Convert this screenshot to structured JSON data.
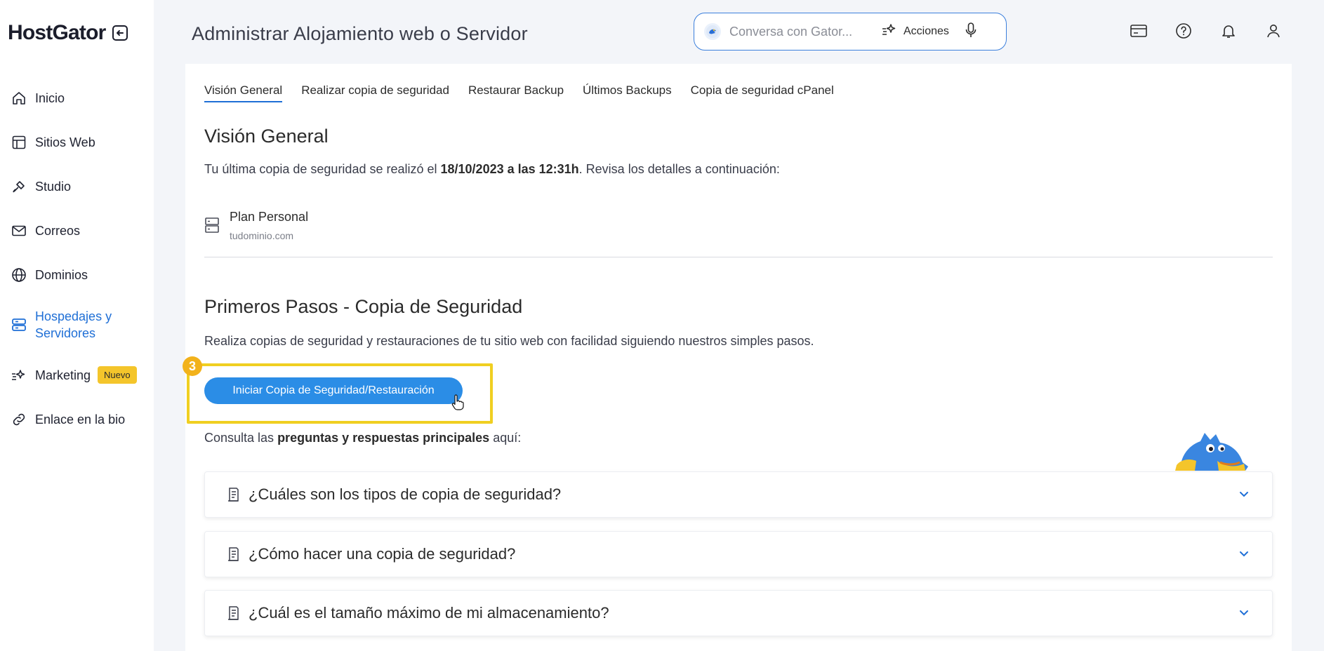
{
  "app": {
    "logo": "HostGator"
  },
  "sidebar": {
    "items": [
      {
        "label": "Inicio",
        "icon": "home-icon"
      },
      {
        "label": "Sitios Web",
        "icon": "layout-icon"
      },
      {
        "label": "Studio",
        "icon": "brush-icon"
      },
      {
        "label": "Correos",
        "icon": "mail-icon"
      },
      {
        "label": "Dominios",
        "icon": "globe-icon"
      },
      {
        "label": "Hospedajes y Servidores",
        "icon": "server-icon",
        "active": true
      },
      {
        "label": "Marketing",
        "icon": "sparkle-icon",
        "badge": "Nuevo"
      },
      {
        "label": "Enlace en la bio",
        "icon": "link-icon"
      }
    ]
  },
  "header": {
    "title": "Administrar Alojamiento web o Servidor",
    "chat": {
      "placeholder": "Conversa con Gator...",
      "actions_label": "Acciones"
    }
  },
  "tabs": [
    "Visión General",
    "Realizar copia de seguridad",
    "Restaurar Backup",
    "Últimos Backups",
    "Copia de seguridad cPanel"
  ],
  "overview": {
    "title": "Visión General",
    "text_before": "Tu última copia de seguridad se realizó el ",
    "date_bold": "18/10/2023 a las 12:31h",
    "text_after": ". Revisa los detalles a continuación:",
    "plan_name": "Plan Personal",
    "plan_domain": "tudominio.com"
  },
  "first_steps": {
    "title": "Primeros Pasos - Copia de Seguridad",
    "description": "Realiza copias de seguridad y restauraciones de tu sitio web con facilidad siguiendo nuestros simples pasos.",
    "step_number": "3",
    "button_label": "Iniciar Copia de Seguridad/Restauración",
    "faq_intro_before": "Consulta las ",
    "faq_intro_bold": "preguntas y respuestas principales",
    "faq_intro_after": " aquí:"
  },
  "faqs": [
    "¿Cuáles son los tipos de copia de seguridad?",
    "¿Cómo hacer una copia de seguridad?",
    "¿Cuál es el tamaño máximo de mi almacenamiento?"
  ],
  "colors": {
    "accent": "#1f6fd6",
    "button": "#2b8de6",
    "highlight": "#f0cf21",
    "badge": "#f4c52b"
  }
}
